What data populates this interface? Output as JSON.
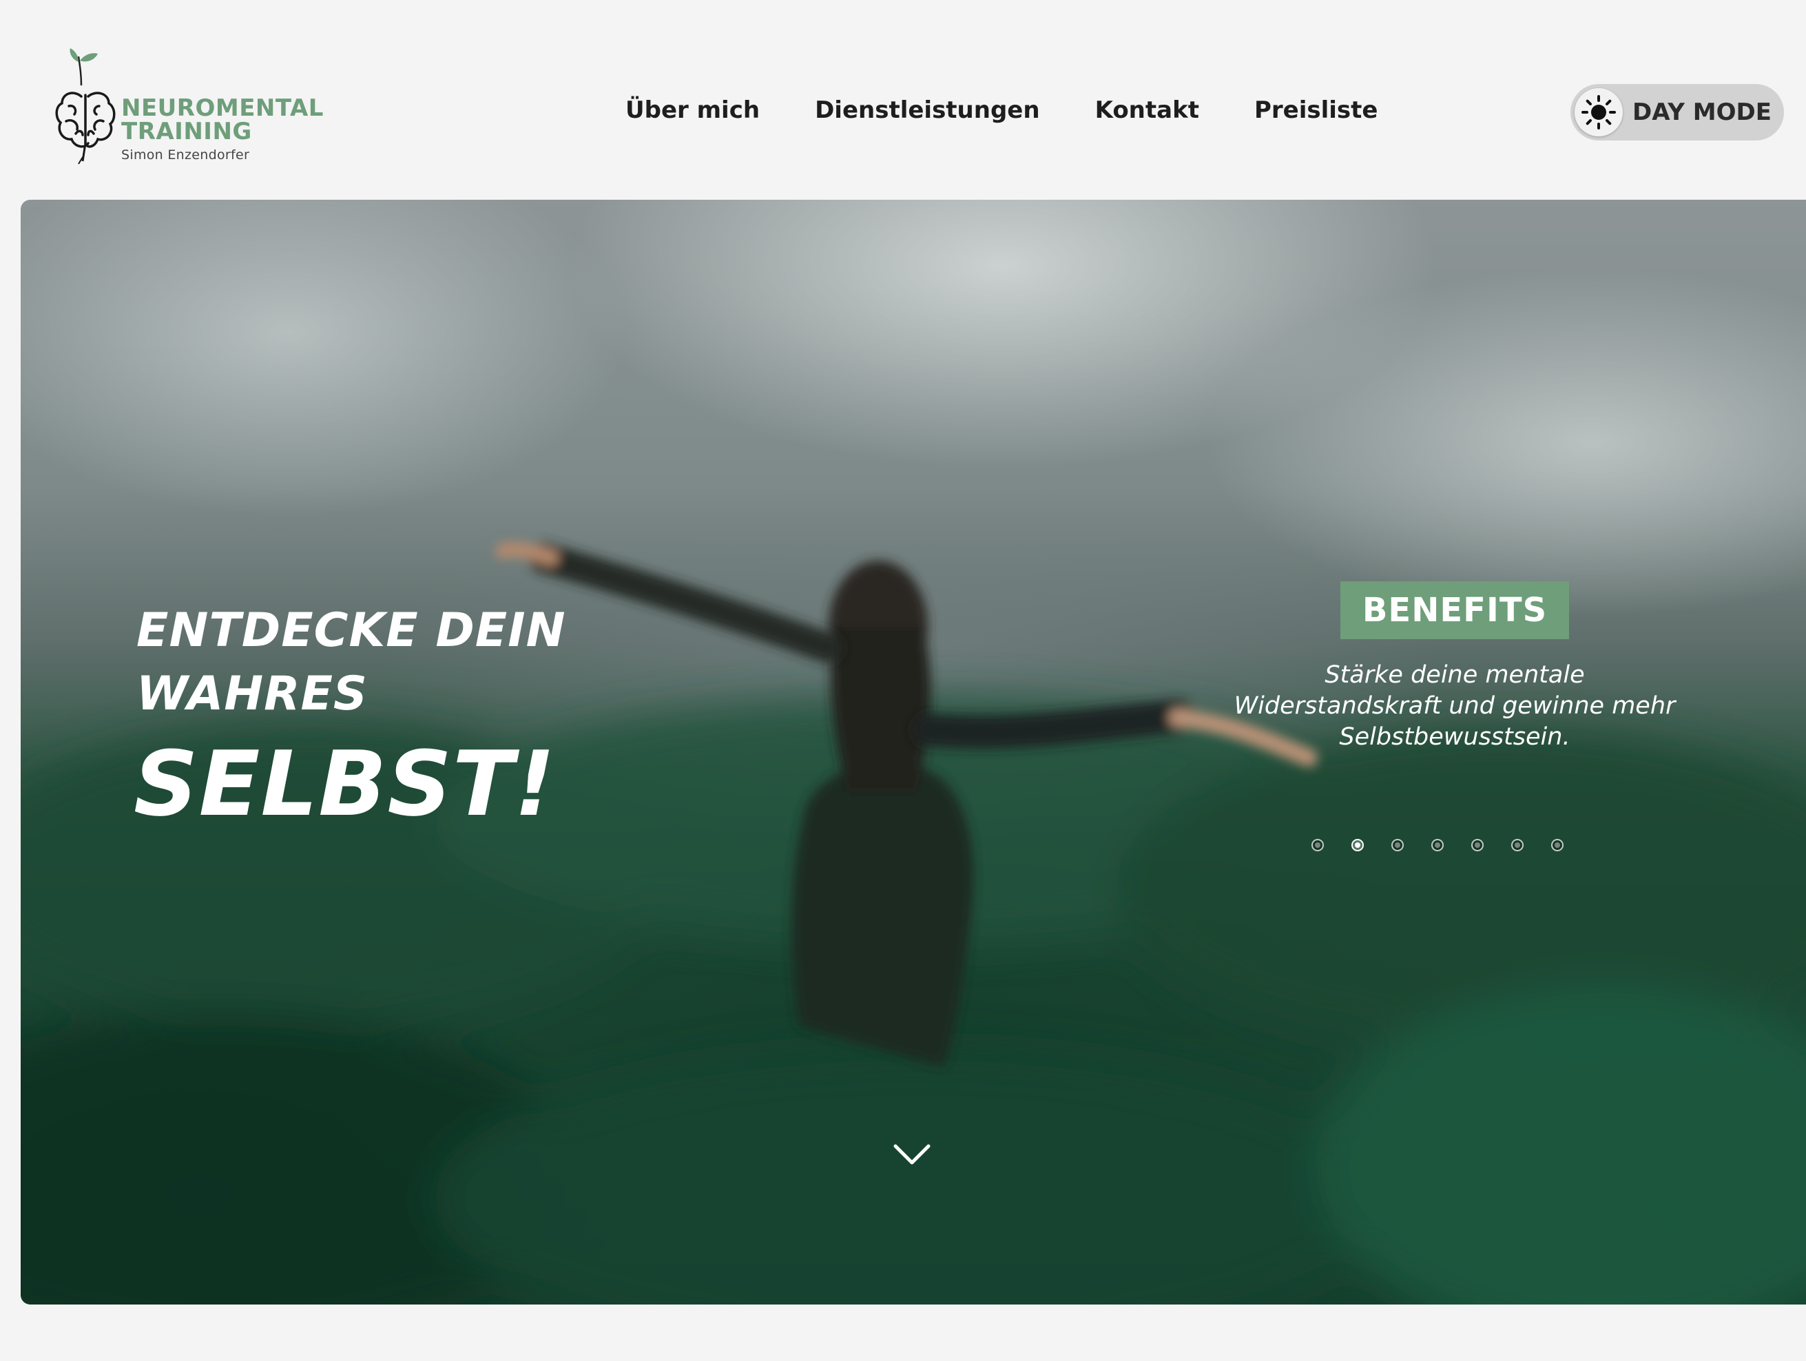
{
  "brand": {
    "name_line1": "NEUROMENTAL",
    "name_line2": "TRAINING",
    "owner": "Simon Enzendorfer",
    "icon": "brain-sprout-logo-icon",
    "color": "#6e9e7a"
  },
  "nav": {
    "items": [
      {
        "label": "Über mich"
      },
      {
        "label": "Dienstleistungen"
      },
      {
        "label": "Kontakt"
      },
      {
        "label": "Preisliste"
      }
    ]
  },
  "mode_toggle": {
    "label": "DAY MODE",
    "icon": "sun-icon"
  },
  "hero": {
    "headline_line1": "ENTDECKE DEIN",
    "headline_line2": "WAHRES",
    "headline_big": "SELBST!",
    "slide": {
      "badge": "BENEFITS",
      "badge_color": "#6e9e7a",
      "text": "Stärke deine mentale Widerstandskraft und gewinne mehr Selbstbewusstsein."
    },
    "slider": {
      "count": 7,
      "active_index": 1
    },
    "scroll_icon": "chevron-down-icon"
  }
}
